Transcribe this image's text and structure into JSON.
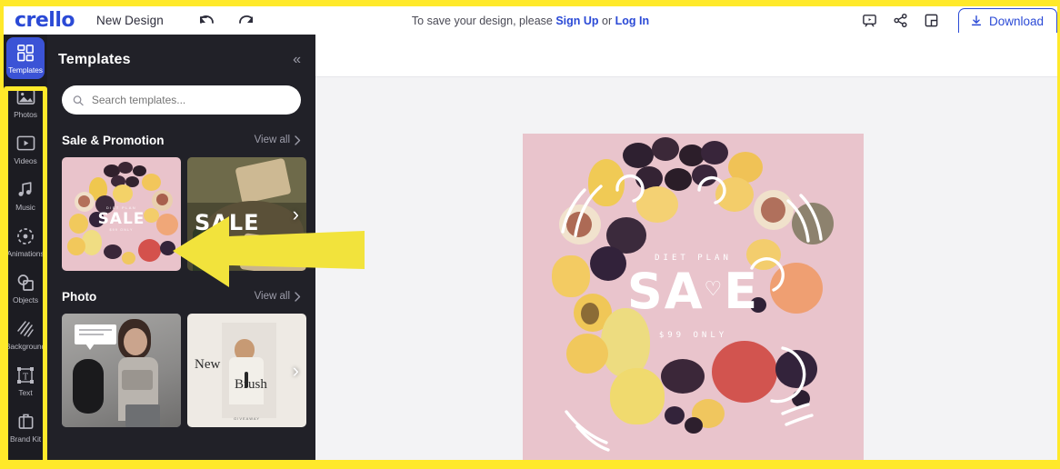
{
  "brand": {
    "logo": "crello",
    "accent": "#2b4ad6",
    "highlight": "#ffe92a"
  },
  "topbar": {
    "doc_title": "New Design",
    "undo_label": "undo-arrow",
    "redo_label": "redo-arrow",
    "save_hint_prefix": "To save your design, please ",
    "sign_up": "Sign Up",
    "save_hint_or": " or ",
    "log_in": "Log In",
    "present_icon": "present-icon",
    "share_icon": "share-icon",
    "resize_icon": "resize-icon",
    "download_label": "Download"
  },
  "sidebar": {
    "items": [
      {
        "label": "Templates",
        "icon": "templates-icon",
        "active": true
      },
      {
        "label": "Photos",
        "icon": "photos-icon",
        "active": false
      },
      {
        "label": "Videos",
        "icon": "videos-icon",
        "active": false
      },
      {
        "label": "Music",
        "icon": "music-icon",
        "active": false
      },
      {
        "label": "Animations",
        "icon": "animations-icon",
        "active": false
      },
      {
        "label": "Objects",
        "icon": "objects-icon",
        "active": false
      },
      {
        "label": "Background",
        "icon": "background-icon",
        "active": false
      },
      {
        "label": "Text",
        "icon": "text-icon",
        "active": false
      },
      {
        "label": "Brand Kit",
        "icon": "brandkit-icon",
        "active": false
      }
    ]
  },
  "panel": {
    "title": "Templates",
    "collapse_icon": "collapse-left-icon",
    "search": {
      "placeholder": "Search templates...",
      "value": "",
      "icon": "search-icon"
    },
    "sections": [
      {
        "title": "Sale & Promotion",
        "view_all": "View all",
        "thumbs": [
          {
            "name": "fruit-sale-template",
            "caption_top": "DIET PLAN",
            "caption_main": "SALE",
            "caption_bottom": "$99 ONLY"
          },
          {
            "name": "champagne-sale-template",
            "caption_main": "SALE",
            "caption_bottom": ""
          }
        ]
      },
      {
        "title": "Photo",
        "view_all": "View all",
        "thumbs": [
          {
            "name": "yoga-mat-photo-template",
            "caption_main": ""
          },
          {
            "name": "new-brush-photo-template",
            "caption_top": "New",
            "caption_main": "Brush",
            "caption_bottom": "GIVEAWAY"
          }
        ]
      }
    ],
    "next_arrow": "›"
  },
  "canvas": {
    "design": {
      "name": "diet-plan-sale-design",
      "eyebrow": "DIET PLAN",
      "headline_left": "SA",
      "headline_heart": "♡",
      "headline_right": "E",
      "subline": "$99 ONLY",
      "background_color": "#e9c4cc"
    },
    "annotation": {
      "type": "arrow",
      "direction": "left",
      "color": "#f2e33c"
    }
  }
}
